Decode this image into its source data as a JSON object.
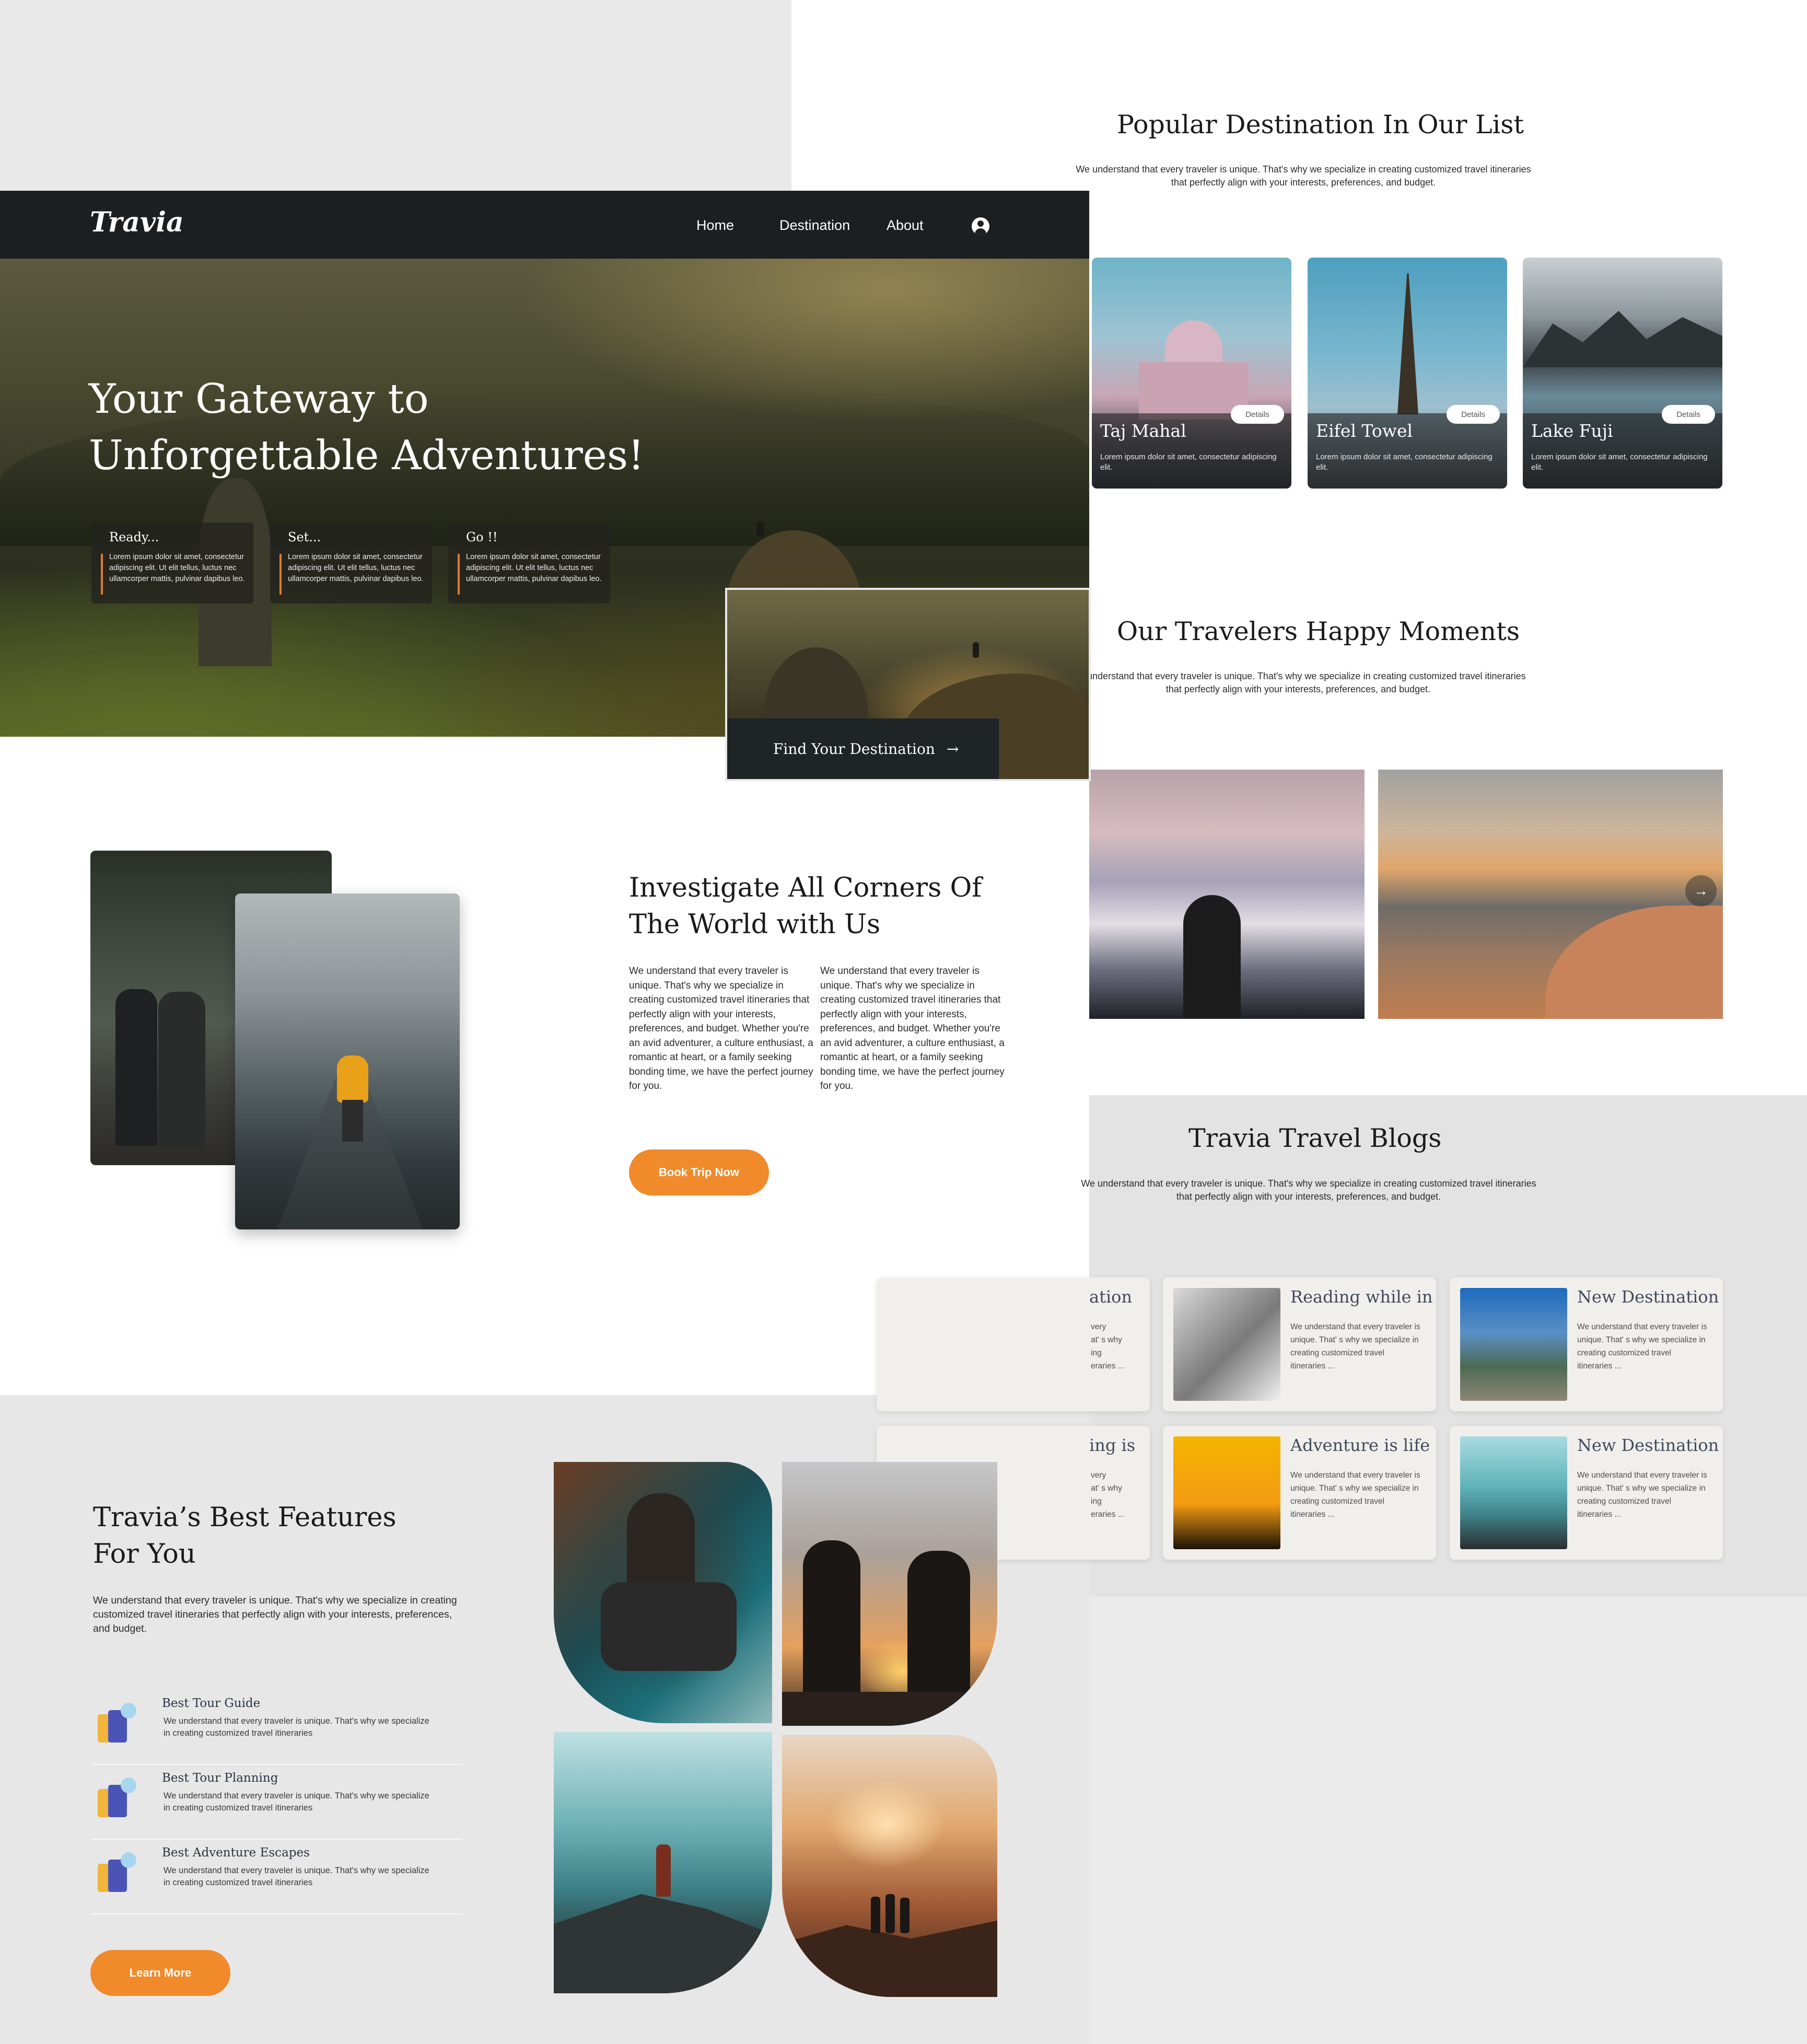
{
  "brand": {
    "logo": "Travia"
  },
  "nav": {
    "items": [
      "Home",
      "Destination",
      "About"
    ]
  },
  "colors": {
    "accent": "#f08a2b",
    "navbar": "#1b1f22"
  },
  "hero": {
    "title_line1": "Your Gateway to",
    "title_line2": "Unforgettable Adventures!",
    "steps": [
      {
        "title": "Ready...",
        "text": "Lorem ipsum dolor sit amet, consectetur adipiscing elit. Ut elit tellus, luctus nec ullamcorper mattis, pulvinar dapibus leo."
      },
      {
        "title": "Set...",
        "text": "Lorem ipsum dolor sit amet, consectetur adipiscing elit. Ut elit tellus, luctus nec ullamcorper mattis, pulvinar dapibus leo."
      },
      {
        "title": "Go !!",
        "text": "Lorem ipsum dolor sit amet, consectetur adipiscing elit. Ut elit tellus, luctus nec ullamcorper mattis, pulvinar dapibus leo."
      }
    ],
    "cta": "Find Your Destination"
  },
  "investigate": {
    "title_line1": "Investigate All Corners Of",
    "title_line2": "The World with Us",
    "col1": "We understand that every traveler is unique. That's why we specialize in creating customized travel itineraries that perfectly align with your interests, preferences, and budget. Whether you're an avid adventurer, a culture enthusiast, a romantic at heart, or a family seeking bonding time, we have the perfect journey for you.",
    "col2": "We understand that every traveler is unique. That's why we specialize in creating customized travel itineraries that perfectly align with your interests, preferences, and budget. Whether you're an avid adventurer, a culture enthusiast, a romantic at heart, or a family seeking bonding time, we have the perfect journey for you.",
    "button": "Book Trip Now"
  },
  "features": {
    "title_line1": "Travia’s Best Features",
    "title_line2": "For You",
    "description": "We understand that every traveler is unique. That's why we specialize in creating customized travel itineraries that perfectly align with your interests, preferences, and budget.",
    "items": [
      {
        "title": "Best Tour Guide",
        "text": "We understand that every traveler is unique. That's why we specialize in creating customized travel itineraries"
      },
      {
        "title": "Best Tour Planning",
        "text": "We understand that every traveler is unique. That's why we specialize in creating customized travel itineraries"
      },
      {
        "title": "Best Adventure Escapes",
        "text": "We understand that every traveler is unique. That's why we specialize in creating customized travel itineraries"
      }
    ],
    "button": "Learn More"
  },
  "popular": {
    "title": "Popular Destination In Our List",
    "description": "We understand that every traveler is unique. That's why we specialize in creating customized travel itineraries that perfectly align with your interests, preferences, and budget.",
    "cards": [
      {
        "name": "Taj Mahal",
        "text": "Lorem ipsum dolor sit amet, consectetur adipiscing elit.",
        "details": "Details"
      },
      {
        "name": "Eifel Towel",
        "text": "Lorem ipsum dolor sit amet, consectetur adipiscing elit.",
        "details": "Details"
      },
      {
        "name": "Lake Fuji",
        "text": "Lorem ipsum dolor sit amet, consectetur adipiscing elit.",
        "details": "Details"
      }
    ]
  },
  "moments": {
    "title": "Our Travelers Happy Moments",
    "description": "We understand that every traveler is unique. That's why we specialize in creating customized travel itineraries that perfectly align with your interests, preferences, and budget."
  },
  "blogs": {
    "title": "Travia Travel Blogs",
    "description": "We understand that every traveler is unique. That's why we specialize in creating customized travel itineraries that perfectly align with your interests, preferences, and budget.",
    "partial_titles": [
      "ation",
      "ing is"
    ],
    "partial_text": "very\nat' s why\ning\neraries ...",
    "cards": [
      {
        "title": "Reading while in",
        "text": "We understand that every traveler is unique. That' s why we specialize in creating customized travel itineraries ..."
      },
      {
        "title": "New Destination",
        "text": "We understand that every traveler is unique. That' s why we specialize in creating customized travel itineraries ..."
      },
      {
        "title": "Adventure is life",
        "text": "We understand that every traveler is unique. That' s why we specialize in creating customized travel itineraries ..."
      },
      {
        "title": "New Destination",
        "text": "We understand that every traveler is unique. That' s why we specialize in creating customized travel itineraries ..."
      }
    ]
  }
}
